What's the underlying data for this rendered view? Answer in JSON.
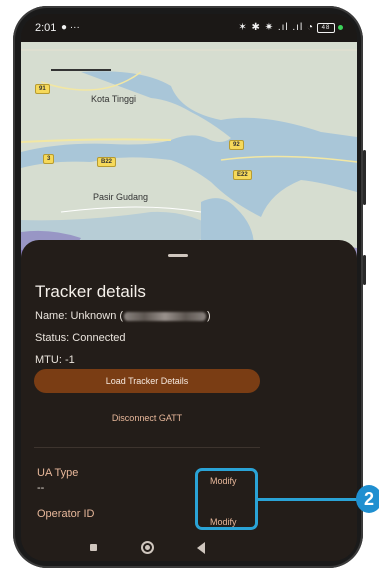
{
  "status_bar": {
    "time": "2:01",
    "left_icons": "● ···",
    "right_icons": "✶ ✱ ✷ .ıl .ıl ◔",
    "battery": "48"
  },
  "map": {
    "labels": [
      "Kota Tinggi",
      "Pasir Gudang"
    ],
    "shields": [
      "91",
      "3",
      "B22",
      "92",
      "E22"
    ],
    "colors": {
      "land": "#d6ddd0",
      "water": "#a9c6d8",
      "urban": "#7a6fae"
    }
  },
  "sheet": {
    "title": "Tracker details",
    "name_prefix": "Name: Unknown (",
    "name_suffix": ")",
    "status": "Status: Connected",
    "mtu": "MTU: -1",
    "load_button": "Load Tracker Details",
    "disconnect_button": "Disconnect GATT",
    "ua_type_label": "UA Type",
    "ua_type_value": "--",
    "modify_1": "Modify",
    "operator_label": "Operator ID",
    "modify_2": "Modify"
  },
  "callout": {
    "number": "2",
    "color": "#1f8fd0"
  }
}
